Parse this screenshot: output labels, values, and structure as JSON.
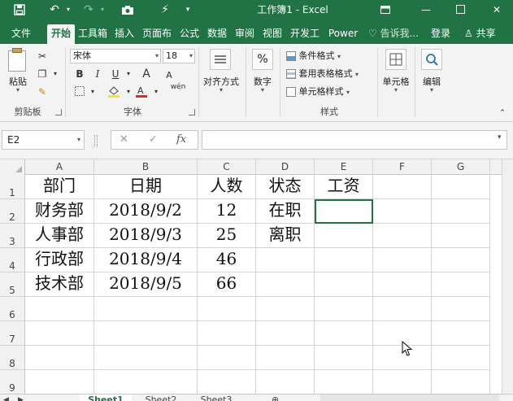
{
  "window": {
    "title": "工作簿1 - Excel",
    "controls": [
      "ribbon-display",
      "minimize",
      "maximize",
      "close"
    ]
  },
  "menu": {
    "tabs": [
      "文件",
      "开始",
      "工具箱",
      "插入",
      "页面布",
      "公式",
      "数据",
      "审阅",
      "视图",
      "开发工",
      "Power"
    ],
    "active": "开始",
    "tell_me": "告诉我...",
    "login": "登录",
    "share": "共享"
  },
  "ribbon": {
    "clipboard": {
      "paste": "粘贴",
      "label": "剪贴板"
    },
    "font": {
      "name": "宋体",
      "size": "18",
      "label": "字体",
      "bold": "B",
      "italic": "I",
      "underline": "U",
      "grow": "A",
      "shrink": "A",
      "phonetic": "wén"
    },
    "alignment": {
      "label": "对齐方式"
    },
    "number": {
      "label": "数字",
      "symbol": "%"
    },
    "styles": {
      "conditional": "条件格式",
      "table": "套用表格格式",
      "cell": "单元格样式",
      "label": "样式"
    },
    "cells": {
      "label": "单元格"
    },
    "editing": {
      "label": "编辑"
    }
  },
  "formula_bar": {
    "name_box": "E2",
    "cancel": "✕",
    "enter": "✓",
    "fx": "fx",
    "value": ""
  },
  "sheet": {
    "columns": [
      "A",
      "B",
      "C",
      "D",
      "E",
      "F",
      "G"
    ],
    "rows": [
      "1",
      "2",
      "3",
      "4",
      "5",
      "6",
      "7",
      "8",
      "9"
    ],
    "cells": [
      [
        "部门",
        "日期",
        "人数",
        "状态",
        "工资",
        "",
        ""
      ],
      [
        "财务部",
        "2018/9/2",
        "12",
        "在职",
        "",
        "",
        ""
      ],
      [
        "人事部",
        "2018/9/3",
        "25",
        "离职",
        "",
        "",
        ""
      ],
      [
        "行政部",
        "2018/9/4",
        "46",
        "",
        "",
        "",
        ""
      ],
      [
        "技术部",
        "2018/9/5",
        "66",
        "",
        "",
        "",
        ""
      ],
      [
        "",
        "",
        "",
        "",
        "",
        "",
        ""
      ],
      [
        "",
        "",
        "",
        "",
        "",
        "",
        ""
      ],
      [
        "",
        "",
        "",
        "",
        "",
        "",
        ""
      ],
      [
        "",
        "",
        "",
        "",
        "",
        "",
        ""
      ]
    ],
    "selected": "E2"
  },
  "sheet_tabs": [
    "Sheet1",
    "Sheet2",
    "Sheet3"
  ],
  "active_sheet": "Sheet1",
  "colors": {
    "accent": "#217346",
    "ribbon_bg": "#f3f3f3",
    "header_bg": "#f2f2f2",
    "gridline": "#d4d4d4"
  }
}
